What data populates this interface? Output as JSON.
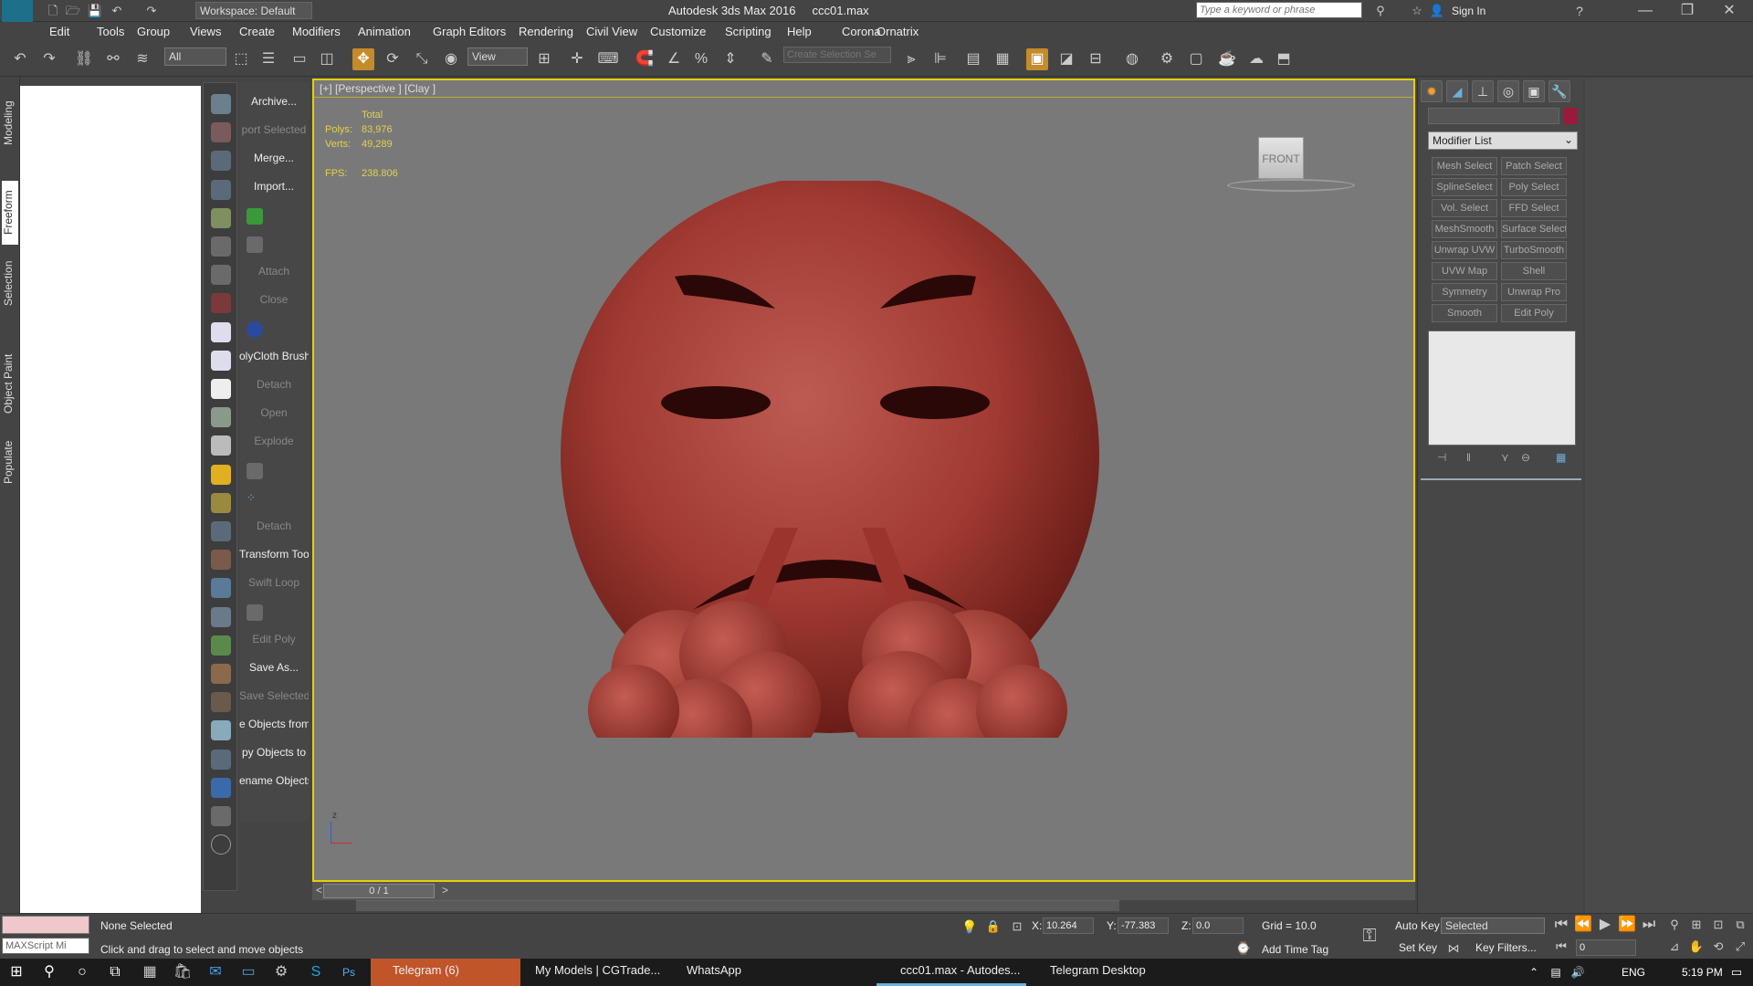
{
  "titlebar": {
    "app_title": "Autodesk 3ds Max 2016",
    "file_name": "ccc01.max",
    "workspace": "Workspace: Default",
    "search_placeholder": "Type a keyword or phrase",
    "sign_in": "Sign In",
    "logo": "MAX"
  },
  "menu": [
    "Edit",
    "Tools",
    "Group",
    "Views",
    "Create",
    "Modifiers",
    "Animation",
    "Graph Editors",
    "Rendering",
    "Civil View",
    "Customize",
    "Scripting",
    "Help",
    "Corona",
    "Ornatrix"
  ],
  "toolbar": {
    "filter_select": "All",
    "ref_coord": "View",
    "selection_set_placeholder": "Create Selection Se"
  },
  "ribbon_tabs": [
    "Modeling",
    "Freeform",
    "Selection",
    "Object Paint",
    "Populate"
  ],
  "script_buttons": [
    {
      "label": "Archive...",
      "dim": false
    },
    {
      "label": "port Selected",
      "dim": true
    },
    {
      "label": "Merge...",
      "dim": false
    },
    {
      "label": "Import...",
      "dim": false
    },
    {
      "label": "",
      "dim": false
    },
    {
      "label": "",
      "dim": false
    },
    {
      "label": "Attach",
      "dim": true
    },
    {
      "label": "Close",
      "dim": true
    },
    {
      "label": "",
      "dim": false
    },
    {
      "label": "olyCloth Brushe",
      "dim": false
    },
    {
      "label": "Detach",
      "dim": true
    },
    {
      "label": "Open",
      "dim": true
    },
    {
      "label": "Explode",
      "dim": true
    },
    {
      "label": "",
      "dim": false
    },
    {
      "label": "",
      "dim": false
    },
    {
      "label": "Detach",
      "dim": true
    },
    {
      "label": "Transform Tool",
      "dim": false
    },
    {
      "label": "Swift Loop",
      "dim": true
    },
    {
      "label": "",
      "dim": false
    },
    {
      "label": "Edit Poly",
      "dim": true
    },
    {
      "label": "Save As...",
      "dim": false
    },
    {
      "label": "Save Selected",
      "dim": true
    },
    {
      "label": "e Objects from",
      "dim": false
    },
    {
      "label": "py Objects to",
      "dim": false
    },
    {
      "label": "ename Objects",
      "dim": false
    }
  ],
  "viewport": {
    "label": "[+] [Perspective ] [Clay ]",
    "stats_header": "Total",
    "polys_label": "Polys:",
    "polys": "83,976",
    "verts_label": "Verts:",
    "verts": "49,289",
    "fps_label": "FPS:",
    "fps": "238.806",
    "viewcube": "FRONT",
    "axis_z": "z"
  },
  "timeline": {
    "frame": "0 / 1"
  },
  "command_panel": {
    "modifier_list": "Modifier List",
    "modifiers": [
      "Mesh Select",
      "Patch Select",
      "SplineSelect",
      "Poly Select",
      "Vol. Select",
      "FFD Select",
      "MeshSmooth",
      "Surface Select",
      "Unwrap UVW",
      "TurboSmooth",
      "UVW Map",
      "Shell",
      "Symmetry",
      "Unwrap Pro",
      "Smooth",
      "Edit Poly"
    ],
    "swatch_color": "#9b1a3a"
  },
  "status": {
    "maxscript": "MAXScript Mi",
    "selection": "None Selected",
    "prompt": "Click and drag to select and move objects",
    "x_label": "X:",
    "x": "10.264",
    "y_label": "Y:",
    "y": "-77.383",
    "z_label": "Z:",
    "z": "0.0",
    "grid": "Grid = 10.0",
    "add_time_tag": "Add Time Tag",
    "auto_key": "Auto Key",
    "set_key": "Set Key",
    "selected_dropdown": "Selected",
    "key_filters": "Key Filters...",
    "frame_field": "0"
  },
  "taskbar": {
    "items": [
      "Telegram (6)",
      "My Models | CGTrade...",
      "WhatsApp",
      "ccc01.max - Autodes...",
      "Telegram Desktop"
    ],
    "lang": "ENG",
    "time": "5:19 PM"
  }
}
